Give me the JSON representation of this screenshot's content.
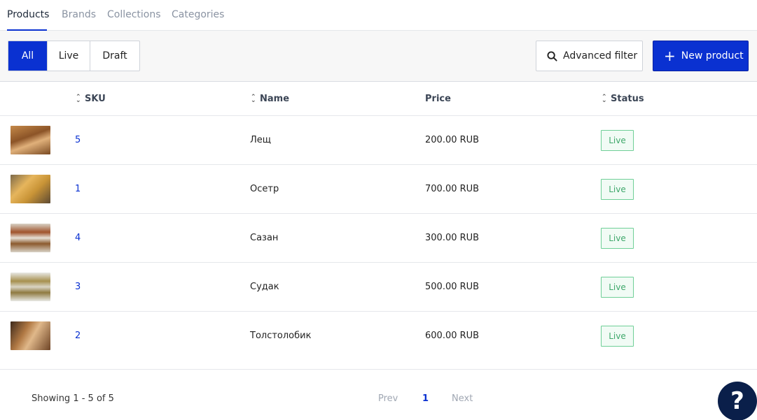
{
  "tabs": [
    {
      "label": "Products",
      "active": true
    },
    {
      "label": "Brands",
      "active": false
    },
    {
      "label": "Collections",
      "active": false
    },
    {
      "label": "Categories",
      "active": false
    }
  ],
  "filter_segments": [
    {
      "label": "All",
      "active": true
    },
    {
      "label": "Live",
      "active": false
    },
    {
      "label": "Draft",
      "active": false
    }
  ],
  "toolbar": {
    "advanced_filter_label": "Advanced filter",
    "new_product_label": "New product",
    "filter_icon": "search-icon",
    "new_icon": "plus-icon"
  },
  "table": {
    "headers": {
      "sku": "SKU",
      "name": "Name",
      "price": "Price",
      "status": "Status"
    },
    "rows": [
      {
        "sku": "5",
        "name": "Лещ",
        "price": "200.00 RUB",
        "status": "Live"
      },
      {
        "sku": "1",
        "name": "Осетр",
        "price": "700.00 RUB",
        "status": "Live"
      },
      {
        "sku": "4",
        "name": "Сазан",
        "price": "300.00 RUB",
        "status": "Live"
      },
      {
        "sku": "3",
        "name": "Судак",
        "price": "500.00 RUB",
        "status": "Live"
      },
      {
        "sku": "2",
        "name": "Толстолобик",
        "price": "600.00 RUB",
        "status": "Live"
      }
    ]
  },
  "footer": {
    "showing": "Showing 1 - 5 of 5",
    "prev": "Prev",
    "page": "1",
    "next": "Next"
  },
  "help_label": "?",
  "colors": {
    "accent": "#0a31d1",
    "live_badge": "#3fa86b",
    "help_button": "#0a1f4a"
  }
}
